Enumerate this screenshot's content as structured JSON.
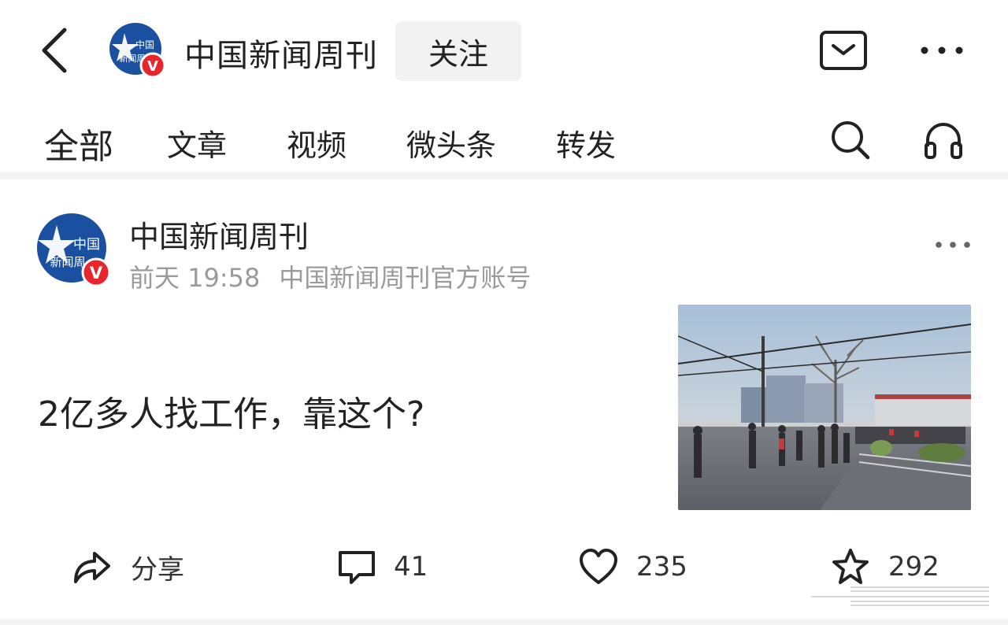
{
  "header": {
    "account_name": "中国新闻周刊",
    "follow_label": "关注"
  },
  "tabs": [
    {
      "label": "全部"
    },
    {
      "label": "文章"
    },
    {
      "label": "视频"
    },
    {
      "label": "微头条"
    },
    {
      "label": "转发"
    }
  ],
  "avatar": {
    "text_line1": "中国",
    "text_line2": "新闻周",
    "badge": "V"
  },
  "post": {
    "author": "中国新闻周刊",
    "time": "前天 19:58",
    "source": "中国新闻周刊官方账号",
    "headline": "2亿多人找工作，靠这个?"
  },
  "actions": {
    "share_label": "分享",
    "comments": "41",
    "likes": "235",
    "favorites": "292"
  },
  "colors": {
    "brand_blue": "#1b4fa0",
    "verified_red": "#e8242c",
    "text_main": "#222222",
    "text_muted": "#9a9a9a"
  },
  "icons": [
    "back-icon",
    "message-icon",
    "more-icon",
    "search-icon",
    "headphones-icon",
    "share-icon",
    "comment-icon",
    "like-icon",
    "star-icon"
  ]
}
